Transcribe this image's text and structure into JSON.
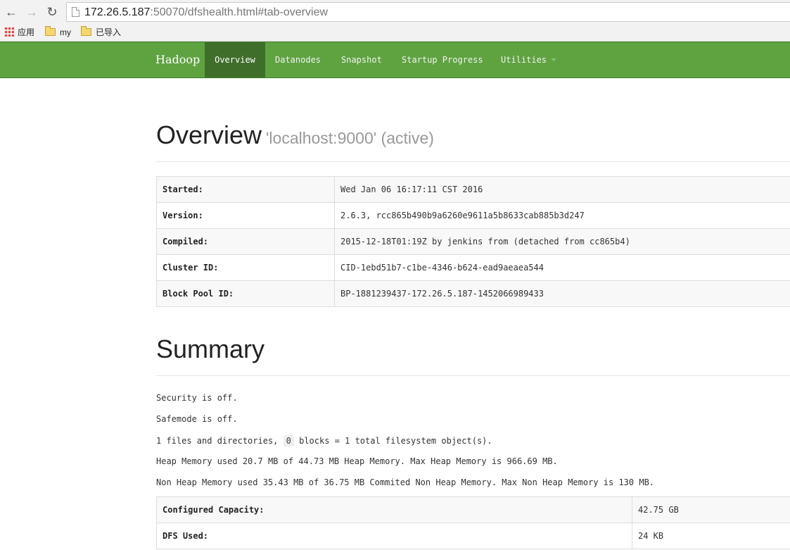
{
  "browser": {
    "url_host": "172.26.5.187",
    "url_rest": ":50070/dfshealth.html#tab-overview",
    "bookmarks": [
      {
        "label": "应用"
      },
      {
        "label": "my"
      },
      {
        "label": "已导入"
      }
    ]
  },
  "navbar": {
    "brand": "Hadoop",
    "items": [
      {
        "label": "Overview",
        "active": true
      },
      {
        "label": "Datanodes"
      },
      {
        "label": "Snapshot"
      },
      {
        "label": "Startup Progress"
      },
      {
        "label": "Utilities",
        "dropdown": true
      }
    ]
  },
  "overview": {
    "title": "Overview",
    "subtitle": "'localhost:9000' (active)",
    "rows": [
      {
        "label": "Started:",
        "value": "Wed Jan 06 16:17:11 CST 2016"
      },
      {
        "label": "Version:",
        "value": "2.6.3, rcc865b490b9a6260e9611a5b8633cab885b3d247"
      },
      {
        "label": "Compiled:",
        "value": "2015-12-18T01:19Z by jenkins from (detached from cc865b4)"
      },
      {
        "label": "Cluster ID:",
        "value": "CID-1ebd51b7-c1be-4346-b624-ead9aeaea544"
      },
      {
        "label": "Block Pool ID:",
        "value": "BP-1881239437-172.26.5.187-1452066989433"
      }
    ]
  },
  "summary": {
    "title": "Summary",
    "security": "Security is off.",
    "safemode": "Safemode is off.",
    "files_prefix": "1 files and directories,",
    "blocks_count": "0",
    "files_suffix": "blocks = 1 total filesystem object(s).",
    "heap": "Heap Memory used 20.7 MB of 44.73 MB Heap Memory. Max Heap Memory is 966.69 MB.",
    "nonheap": "Non Heap Memory used 35.43 MB of 36.75 MB Commited Non Heap Memory. Max Non Heap Memory is 130 MB.",
    "rows": [
      {
        "label": "Configured Capacity:",
        "value": "42.75 GB"
      },
      {
        "label": "DFS Used:",
        "value": "24 KB"
      }
    ]
  },
  "colors": {
    "navbar": "#5fa341",
    "navbar_active": "#3f6e2b"
  }
}
